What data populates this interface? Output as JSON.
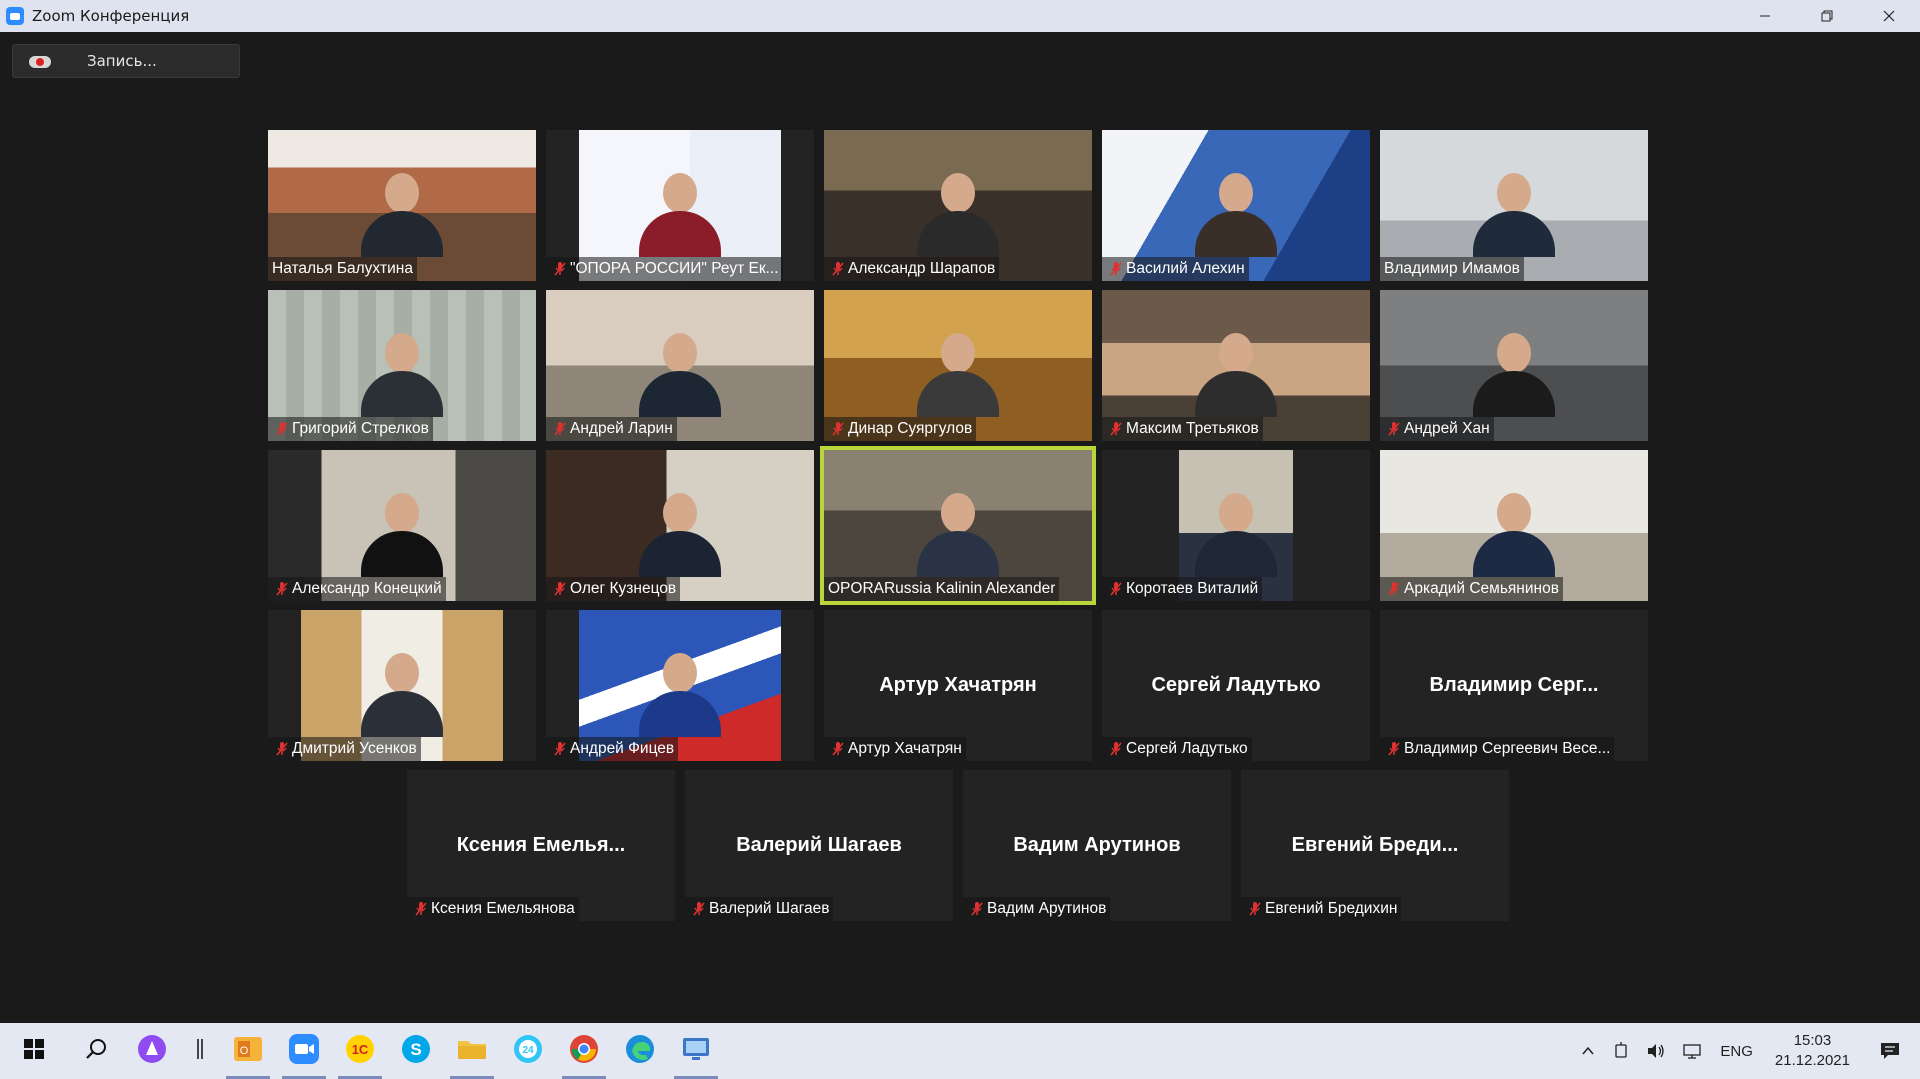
{
  "window": {
    "title": "Zoom Конференция",
    "controls": {
      "minimize": "—",
      "restore": "❐",
      "close": "✕"
    }
  },
  "recording": {
    "label": "Запись..."
  },
  "participants": [
    {
      "label": "Наталья Балухтина",
      "muted": false,
      "video": true
    },
    {
      "label": "\"ОПОРА РОССИИ\" Реут Ек...",
      "muted": true,
      "video": true
    },
    {
      "label": "Александр Шарапов",
      "muted": true,
      "video": true
    },
    {
      "label": "Василий Алехин",
      "muted": true,
      "video": true
    },
    {
      "label": "Владимир Имамов",
      "muted": false,
      "video": true
    },
    {
      "label": "Григорий Стрелков",
      "muted": true,
      "video": true
    },
    {
      "label": "Андрей Ларин",
      "muted": true,
      "video": true
    },
    {
      "label": "Динар Суяргулов",
      "muted": true,
      "video": true
    },
    {
      "label": "Максим Третьяков",
      "muted": true,
      "video": true
    },
    {
      "label": "Андрей Хан",
      "muted": true,
      "video": true
    },
    {
      "label": "Александр Конецкий",
      "muted": true,
      "video": true
    },
    {
      "label": "Олег Кузнецов",
      "muted": true,
      "video": true
    },
    {
      "label": "OPORARussia Kalinin Alexander",
      "muted": false,
      "video": true,
      "speaking": true
    },
    {
      "label": "Коротаев Виталий",
      "muted": true,
      "video": true
    },
    {
      "label": "Аркадий Семьянинов",
      "muted": true,
      "video": true
    },
    {
      "label": "Дмитрий Усенков",
      "muted": true,
      "video": true
    },
    {
      "label": "Андрей Фицев",
      "muted": true,
      "video": true
    },
    {
      "label": "Артур Хачатрян",
      "muted": true,
      "video": false,
      "display_name": "Артур Хачатрян"
    },
    {
      "label": "Сергей Ладутько",
      "muted": true,
      "video": false,
      "display_name": "Сергей Ладутько"
    },
    {
      "label": "Владимир Сергеевич Весе...",
      "muted": true,
      "video": false,
      "display_name": "Владимир Серг..."
    },
    {
      "label": "Ксения Емельянова",
      "muted": true,
      "video": false,
      "display_name": "Ксения Емелья..."
    },
    {
      "label": "Валерий Шагаев",
      "muted": true,
      "video": false,
      "display_name": "Валерий Шагаев"
    },
    {
      "label": "Вадим Арутинов",
      "muted": true,
      "video": false,
      "display_name": "Вадим Арутинов"
    },
    {
      "label": "Евгений Бредихин",
      "muted": true,
      "video": false,
      "display_name": "Евгений Бреди..."
    }
  ],
  "taskbar": {
    "apps": [
      {
        "name": "start",
        "icon": "windows-icon"
      },
      {
        "name": "search",
        "icon": "search-icon"
      },
      {
        "name": "assistant",
        "icon": "alice-icon"
      },
      {
        "name": "separator",
        "icon": "separator-icon"
      },
      {
        "name": "outlook",
        "icon": "outlook-icon",
        "active": true
      },
      {
        "name": "zoom",
        "icon": "zoom-icon",
        "active": true
      },
      {
        "name": "1c",
        "icon": "1c-icon",
        "active": true
      },
      {
        "name": "skype",
        "icon": "skype-icon"
      },
      {
        "name": "explorer",
        "icon": "folder-icon",
        "active": true
      },
      {
        "name": "bitrix24",
        "icon": "bitrix24-icon"
      },
      {
        "name": "chrome",
        "icon": "chrome-icon",
        "active": true
      },
      {
        "name": "edge",
        "icon": "edge-icon"
      },
      {
        "name": "remote-desktop",
        "icon": "remote-desktop-icon",
        "active": true
      }
    ],
    "tray": {
      "language": "ENG",
      "time": "15:03",
      "date": "21.12.2021"
    }
  },
  "colors": {
    "speaking_border": "#b8d53a",
    "mute_icon": "#e03131",
    "tile_bg": "#232323",
    "meeting_bg": "#1a1a1a"
  }
}
